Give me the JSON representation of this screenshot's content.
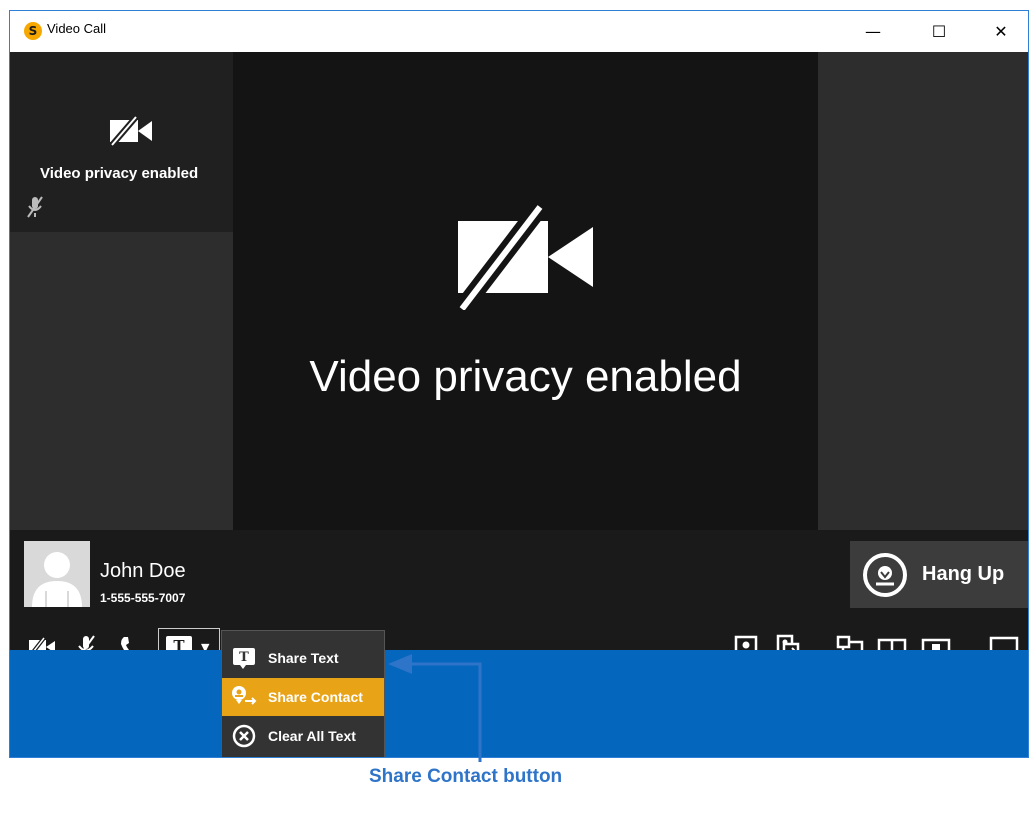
{
  "window": {
    "title": "Video Call",
    "logo_letter": "S"
  },
  "window_controls": {
    "minimize": "—",
    "maximize": "☐",
    "close": "✕"
  },
  "self_view": {
    "status": "Video privacy enabled"
  },
  "main_view": {
    "status": "Video privacy enabled"
  },
  "caller": {
    "name": "John Doe",
    "number": "1-555-555-7007"
  },
  "hang_up": {
    "label": "Hang Up"
  },
  "share_menu": {
    "items": [
      {
        "label": "Share Text",
        "icon": "share-text-icon"
      },
      {
        "label": "Share Contact",
        "icon": "share-contact-icon",
        "highlighted": true
      },
      {
        "label": "Clear All Text",
        "icon": "clear-text-icon"
      }
    ]
  },
  "callout": {
    "label": "Share Contact button"
  },
  "colors": {
    "accent": "#e8a317",
    "taskbar": "#0566bd",
    "callout": "#2e74c8"
  }
}
